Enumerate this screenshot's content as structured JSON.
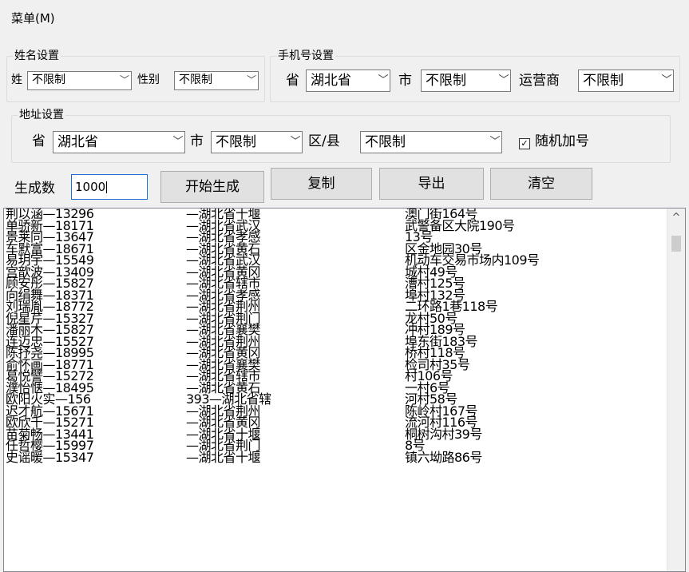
{
  "menu": {
    "label": "菜单(M)"
  },
  "name_settings": {
    "legend": "姓名设置",
    "surname_label": "姓",
    "surname_value": "不限制",
    "gender_label": "性别",
    "gender_value": "不限制"
  },
  "phone_settings": {
    "legend": "手机号设置",
    "province_label": "省",
    "province_value": "湖北省",
    "city_label": "市",
    "city_value": "不限制",
    "carrier_label": "运营商",
    "carrier_value": "不限制"
  },
  "address_settings": {
    "legend": "地址设置",
    "province_label": "省",
    "province_value": "湖北省",
    "city_label": "市",
    "city_value": "不限制",
    "district_label": "区/县",
    "district_value": "不限制",
    "random_suffix_label": "随机加号",
    "random_suffix_checked": true
  },
  "generate": {
    "count_label": "生成数",
    "count_value": "1000"
  },
  "buttons": {
    "start": "开始生成",
    "copy": "复制",
    "export": "导出",
    "clear": "清空"
  },
  "output": {
    "names": [
      "荆以涵—13296",
      "单骄新—18171",
      "景莱同—13647",
      "车默富—18671",
      "易玥宇—15549",
      "宫歆波—13409",
      "顾安彤—15827",
      "向绢舞—18371",
      "刘瑞胤—18772",
      "倪星芹—15327",
      "潘丽木—15827",
      "连迈忠—15527",
      "陈抒尧—18995",
      "俞怀画—18771",
      "葛悦譬—15272",
      "濮怡惬—18495",
      "欧阳火实—156",
      "迟才航—15671",
      "欧欣千—15271",
      "苗菊畅—13441",
      "任哲樱—15997",
      "史谣暖—15347"
    ],
    "addresses": [
      "—湖北省十堰",
      "—湖北省武汉",
      "—湖北省孝感",
      "—湖北省黄石",
      "—湖北省武汉",
      "—湖北省黄冈",
      "—湖北省辖市",
      "—湖北省孝感",
      "—湖北省荆州",
      "—湖北省荆门",
      "—湖北省襄樊",
      "—湖北省荆州",
      "—湖北省黄冈",
      "—湖北省襄樊",
      "—湖北省辖市",
      "—湖北省黄石",
      "393—湖北省辖",
      "—湖北省荆州",
      "—湖北省黄冈",
      "—湖北省十堰",
      "—湖北省荆门",
      "—湖北省十堰"
    ],
    "streets": [
      "澳门街164号",
      "武警备区大院190号",
      "13号",
      "区金地园30号",
      "机动车交易市场内109号",
      "城村49号",
      "漕村125号",
      "埠村132号",
      "二环路1巷118号",
      "龙村50号",
      "冲村189号",
      "埠东街183号",
      "桥村118号",
      "检司村35号",
      "村106号",
      "一村6号",
      "河村58号",
      "陈岭村167号",
      "流河村116号",
      "桐树沟村39号",
      "8号",
      "镇六坳路86号"
    ]
  }
}
